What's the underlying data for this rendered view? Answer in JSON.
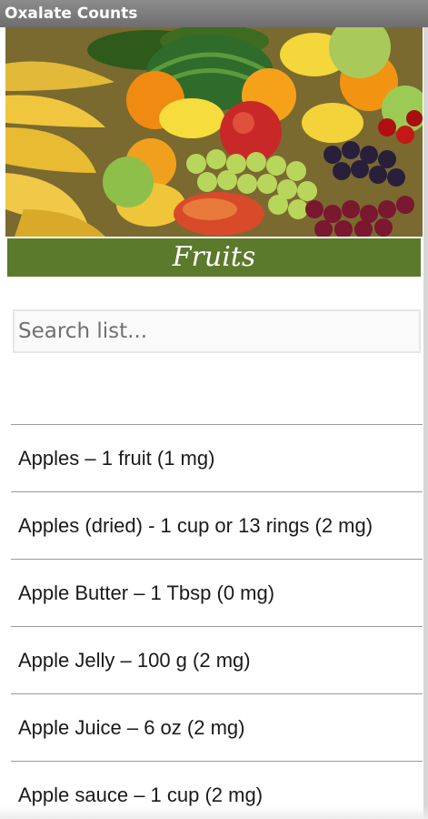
{
  "app": {
    "title": "Oxalate Counts"
  },
  "banner": {
    "icon": "fruit-banner-image"
  },
  "section": {
    "title": "Fruits"
  },
  "search": {
    "placeholder": "Search list...",
    "value": ""
  },
  "list": {
    "items": [
      {
        "label": "Apples – 1 fruit  (1 mg)"
      },
      {
        "label": "Apples (dried) - 1 cup or 13 rings (2 mg)"
      },
      {
        "label": "Apple Butter – 1 Tbsp (0 mg)"
      },
      {
        "label": "Apple Jelly – 100 g (2 mg)"
      },
      {
        "label": "Apple Juice – 6 oz (2 mg)"
      },
      {
        "label": "Apple sauce – 1 cup (2 mg)"
      }
    ]
  },
  "colors": {
    "header_green": "#5b7a2b",
    "titlebar": "#7d7d7d",
    "divider": "#9a9a9a"
  }
}
